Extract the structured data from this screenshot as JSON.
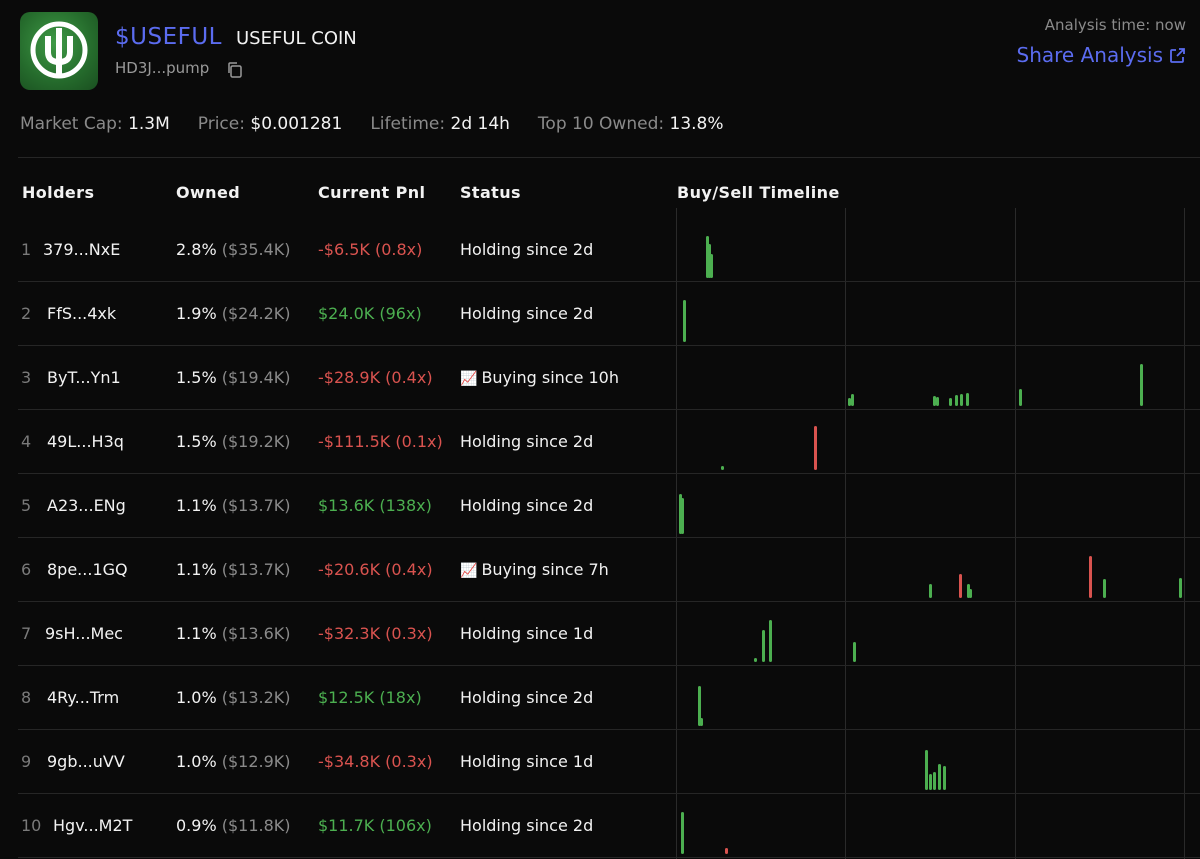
{
  "token": {
    "ticker": "$USEFUL",
    "name": "USEFUL COIN",
    "address": "HD3J...pump"
  },
  "analysis_time": "Analysis time: now",
  "share_label": "Share Analysis",
  "stats": {
    "market_cap_label": "Market Cap:",
    "market_cap": "1.3M",
    "price_label": "Price:",
    "price": "$0.001281",
    "lifetime_label": "Lifetime:",
    "lifetime": "2d 14h",
    "top10_label": "Top 10 Owned:",
    "top10": "13.8%"
  },
  "columns": [
    "Holders",
    "Owned",
    "Current Pnl",
    "Status",
    "Buy/Sell Timeline"
  ],
  "colors": {
    "positive": "#4caf50",
    "negative": "#d9534f",
    "accent": "#5b6cf0"
  },
  "holders": [
    {
      "rank": "1",
      "wallet": "379...NxE",
      "owned": "2.8%",
      "owned_usd": "($35.4K)",
      "pnl": "-$6.5K (0.8x)",
      "pnl_sign": "neg",
      "status": "Holding since 2d",
      "status_icon": ""
    },
    {
      "rank": "2",
      "wallet": "FfS...4xk",
      "owned": "1.9%",
      "owned_usd": "($24.2K)",
      "pnl": "$24.0K (96x)",
      "pnl_sign": "pos",
      "status": "Holding since 2d",
      "status_icon": ""
    },
    {
      "rank": "3",
      "wallet": "ByT...Yn1",
      "owned": "1.5%",
      "owned_usd": "($19.4K)",
      "pnl": "-$28.9K (0.4x)",
      "pnl_sign": "neg",
      "status": "Buying since 10h",
      "status_icon": "📈"
    },
    {
      "rank": "4",
      "wallet": "49L...H3q",
      "owned": "1.5%",
      "owned_usd": "($19.2K)",
      "pnl": "-$111.5K (0.1x)",
      "pnl_sign": "neg",
      "status": "Holding since 2d",
      "status_icon": ""
    },
    {
      "rank": "5",
      "wallet": "A23...ENg",
      "owned": "1.1%",
      "owned_usd": "($13.7K)",
      "pnl": "$13.6K (138x)",
      "pnl_sign": "pos",
      "status": "Holding since 2d",
      "status_icon": ""
    },
    {
      "rank": "6",
      "wallet": "8pe...1GQ",
      "owned": "1.1%",
      "owned_usd": "($13.7K)",
      "pnl": "-$20.6K (0.4x)",
      "pnl_sign": "neg",
      "status": "Buying since 7h",
      "status_icon": "📈"
    },
    {
      "rank": "7",
      "wallet": "9sH...Mec",
      "owned": "1.1%",
      "owned_usd": "($13.6K)",
      "pnl": "-$32.3K (0.3x)",
      "pnl_sign": "neg",
      "status": "Holding since 1d",
      "status_icon": ""
    },
    {
      "rank": "8",
      "wallet": "4Ry...Trm",
      "owned": "1.0%",
      "owned_usd": "($13.2K)",
      "pnl": "$12.5K (18x)",
      "pnl_sign": "pos",
      "status": "Holding since 2d",
      "status_icon": ""
    },
    {
      "rank": "9",
      "wallet": "9gb...uVV",
      "owned": "1.0%",
      "owned_usd": "($12.9K)",
      "pnl": "-$34.8K (0.3x)",
      "pnl_sign": "neg",
      "status": "Holding since 1d",
      "status_icon": ""
    },
    {
      "rank": "10",
      "wallet": "Hgv...M2T",
      "owned": "0.9%",
      "owned_usd": "($11.8K)",
      "pnl": "$11.7K (106x)",
      "pnl_sign": "pos",
      "status": "Holding since 2d",
      "status_icon": ""
    }
  ]
}
